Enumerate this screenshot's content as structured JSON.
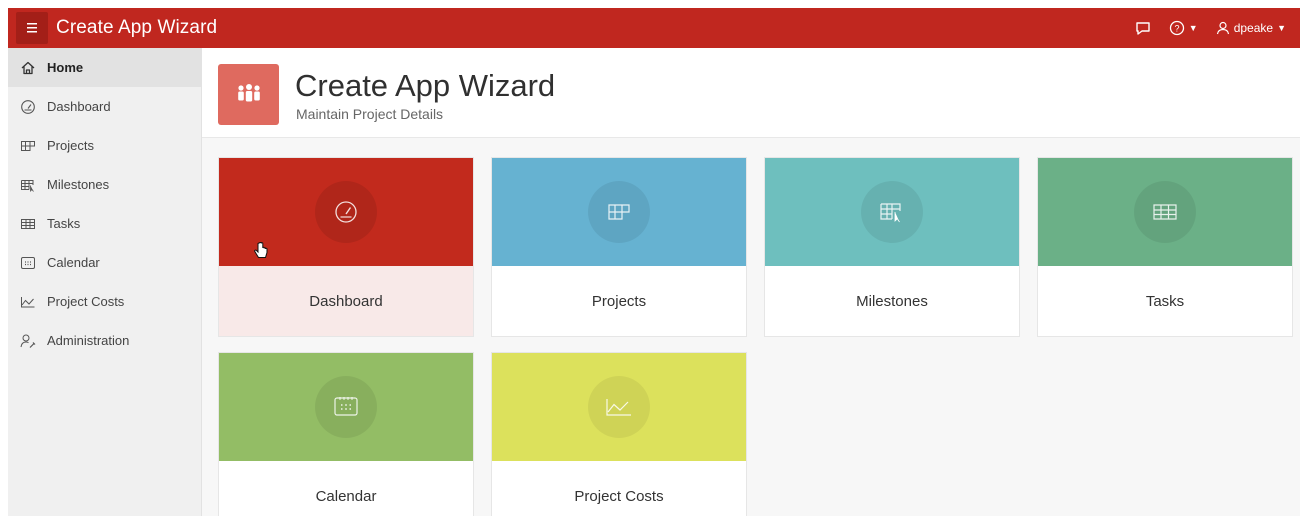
{
  "header": {
    "app_title": "Create App Wizard",
    "user_name": "dpeake"
  },
  "sidebar": {
    "items": [
      {
        "label": "Home",
        "icon": "home-icon",
        "active": true
      },
      {
        "label": "Dashboard",
        "icon": "dashboard-gauge-icon"
      },
      {
        "label": "Projects",
        "icon": "projects-grid-icon"
      },
      {
        "label": "Milestones",
        "icon": "milestones-table-icon"
      },
      {
        "label": "Tasks",
        "icon": "tasks-table-icon"
      },
      {
        "label": "Calendar",
        "icon": "calendar-icon"
      },
      {
        "label": "Project Costs",
        "icon": "line-chart-icon"
      },
      {
        "label": "Administration",
        "icon": "user-wrench-icon"
      }
    ]
  },
  "hero": {
    "title": "Create App Wizard",
    "subtitle": "Maintain Project Details",
    "icon": "people-group-icon"
  },
  "cards": [
    {
      "label": "Dashboard",
      "icon": "dashboard-gauge-icon",
      "color": "#c22a1d",
      "selected": true
    },
    {
      "label": "Projects",
      "icon": "projects-grid-icon",
      "color": "#66b2d1"
    },
    {
      "label": "Milestones",
      "icon": "milestones-table-icon",
      "color": "#6ebfbe"
    },
    {
      "label": "Tasks",
      "icon": "tasks-table-icon",
      "color": "#6bb087"
    },
    {
      "label": "Calendar",
      "icon": "calendar-icon",
      "color": "#93bd65"
    },
    {
      "label": "Project Costs",
      "icon": "line-chart-icon",
      "color": "#dce15c"
    }
  ],
  "colors": {
    "brand_red": "#c0271f",
    "sidebar_bg": "#f0f0f0",
    "hero_icon_bg": "#df6a5f"
  }
}
